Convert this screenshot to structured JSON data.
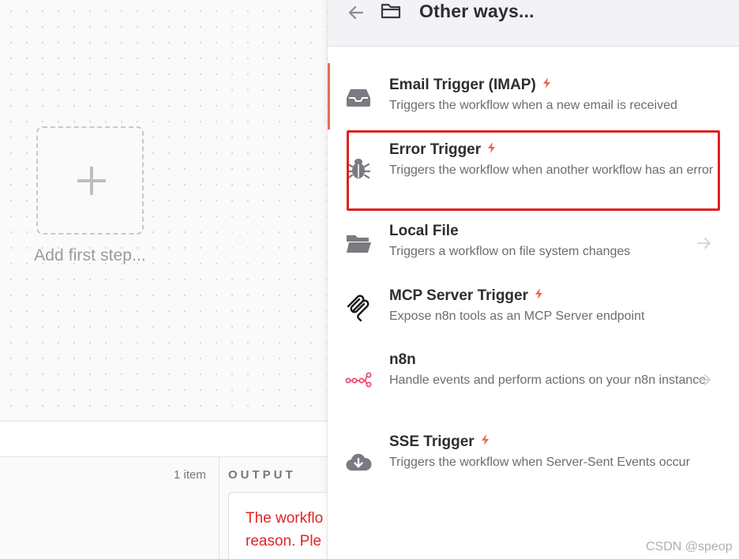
{
  "canvas": {
    "add_first_step": "Add first step..."
  },
  "bottom": {
    "items_count": "1 item",
    "output_label": "OUTPUT",
    "error_lines": [
      "The workflo",
      "reason. Ple"
    ]
  },
  "panel": {
    "title": "Other ways...",
    "back_icon": "arrow-left-icon",
    "header_icon": "folder-open-icon",
    "items": [
      {
        "name": "Email Trigger (IMAP)",
        "description": "Triggers the workflow when a new email is received",
        "icon": "inbox-icon",
        "trigger": true,
        "arrow": false
      },
      {
        "name": "Error Trigger",
        "description": "Triggers the workflow when another workflow has an error",
        "icon": "bug-icon",
        "trigger": true,
        "arrow": false,
        "highlighted": true
      },
      {
        "name": "Local File",
        "description": "Triggers a workflow on file system changes",
        "icon": "folder-icon",
        "trigger": false,
        "arrow": true
      },
      {
        "name": "MCP Server Trigger",
        "description": "Expose n8n tools as an MCP Server endpoint",
        "icon": "mcp-icon",
        "trigger": true,
        "arrow": false
      },
      {
        "name": "n8n",
        "description": "Handle events and perform actions on your n8n instance",
        "icon": "n8n-logo-icon",
        "trigger": false,
        "arrow": true
      },
      {
        "name": "SSE Trigger",
        "description": "Triggers the workflow when Server-Sent Events occur",
        "icon": "cloud-download-icon",
        "trigger": true,
        "arrow": false
      }
    ]
  },
  "colors": {
    "accent": "#ea6a55",
    "highlight_border": "#e02020",
    "error_text": "#e02424",
    "n8n_brand": "#ea4b71"
  },
  "watermark": "CSDN @speop"
}
